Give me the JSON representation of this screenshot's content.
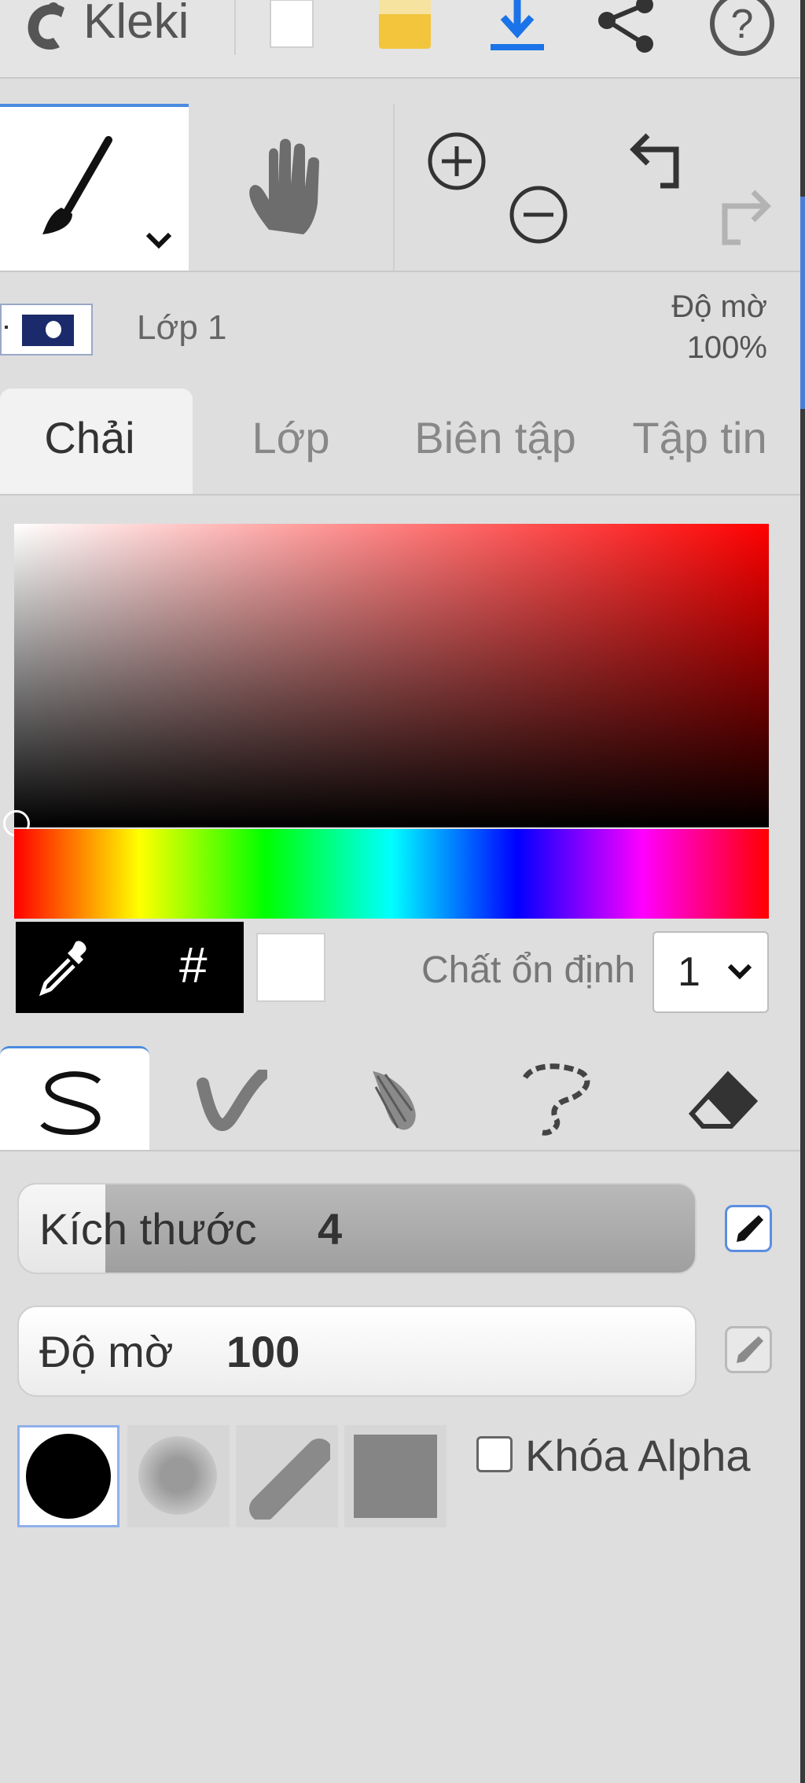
{
  "app": {
    "name": "Kleki",
    "colors": {
      "accent": "#4a8be0",
      "active_tab_bg": "#f2f2f2",
      "panel_bg": "#dedede"
    }
  },
  "topbar": {
    "icons": [
      "kleki-logo-icon",
      "new-file-icon",
      "open-folder-icon",
      "download-icon",
      "share-icon",
      "help-icon"
    ]
  },
  "tools": {
    "icons": [
      "brush-icon",
      "chevron-down-icon",
      "hand-icon",
      "zoom-in-icon",
      "zoom-out-icon",
      "undo-icon",
      "redo-icon"
    ]
  },
  "layer": {
    "name": "Lớp 1",
    "opacity_label": "Độ mờ",
    "opacity_value": "100%"
  },
  "tabs": [
    {
      "label": "Chải"
    },
    {
      "label": "Lớp"
    },
    {
      "label": "Biên tập"
    },
    {
      "label": "Tập tin"
    }
  ],
  "color": {
    "hex_symbol": "#",
    "current": "#ffffff",
    "stabilizer_label": "Chất ổn định",
    "stabilizer_value": "1"
  },
  "brush_types": [
    "pen-brush-icon",
    "blend-brush-icon",
    "sketchy-brush-icon",
    "pixel-brush-icon",
    "eraser-icon"
  ],
  "sliders": {
    "size_label": "Kích thước",
    "size_value": "4",
    "opacity_label": "Độ mờ",
    "opacity_value": "100"
  },
  "shapes": [
    "circle-tip",
    "soft-tip",
    "chisel-tip",
    "square-tip"
  ],
  "alpha_lock": {
    "label": "Khóa Alpha",
    "checked": false
  }
}
